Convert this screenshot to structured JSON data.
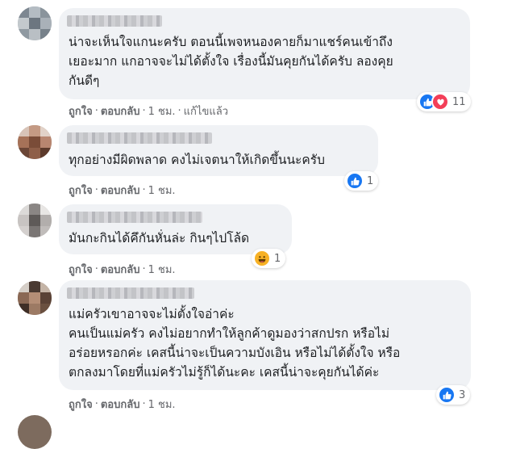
{
  "comments": [
    {
      "text": "น่าจะเห็นใจแกนะครับ ตอนนี้เพจหนองคายก็มาแชร์คนเข้าถึง\nเยอะมาก แกอาจจะไม่ได้ตั้งใจ เรื่องนี้มันคุยกันได้ครับ ลองคุย\nกันดีๆ",
      "like": "ถูกใจ",
      "reply": "ตอบกลับ",
      "time": "1 ชม.",
      "edited": "แก้ไขแล้ว",
      "reaction_count": "11",
      "reactions": [
        "like-icon",
        "love-icon"
      ]
    },
    {
      "text": "ทุกอย่างมีผิดพลาด คงไม่เจตนาให้เกิดขึ้นนะครับ",
      "like": "ถูกใจ",
      "reply": "ตอบกลับ",
      "time": "1 ชม.",
      "reaction_count": "1",
      "reactions": [
        "like-icon"
      ]
    },
    {
      "text": "มันกะกินได้คึกันหั่นล่ะ กินๆไปโล้ด",
      "like": "ถูกใจ",
      "reply": "ตอบกลับ",
      "time": "1 ชม.",
      "reaction_count": "1",
      "reactions": [
        "haha-icon"
      ]
    },
    {
      "text": "แม่ครัวเขาอาจจะไม่ตั้งใจอ่าค่ะ\nคนเป็นแม่ครัว คงไม่อยากทำให้ลูกค้าดูมองว่าสกปรก หรือไม่\nอร่อยหรอกค่ะ เคสนี้น่าจะเป็นความบังเอิน หรือไม่ได้ตั้งใจ หรือ\nตกลงมาโดยที่แม่ครัวไม่รู้ก็ได้นะคะ เคสนี้น่าจะคุยกันได้ค่ะ",
      "like": "ถูกใจ",
      "reply": "ตอบกลับ",
      "time": "1 ชม.",
      "reaction_count": "3",
      "reactions": [
        "like-icon"
      ]
    }
  ],
  "ui": {
    "dot": "·"
  },
  "colors": {
    "like": "#1877f2",
    "love": "#f33e58",
    "haha": "#f7b125",
    "bubble": "#f0f2f5"
  }
}
